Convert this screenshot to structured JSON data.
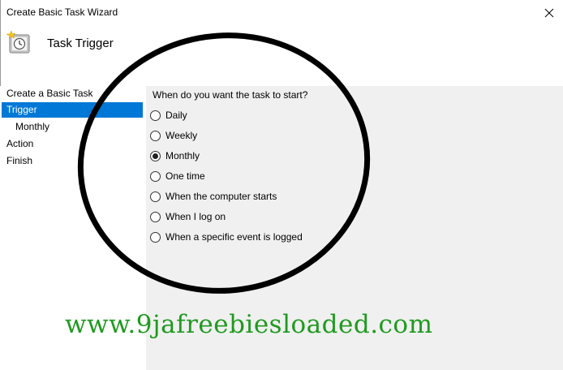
{
  "window": {
    "title": "Create Basic Task Wizard",
    "close_icon": "close-icon"
  },
  "header": {
    "title": "Task Trigger",
    "icon": "clock-icon"
  },
  "sidebar": {
    "items": [
      {
        "label": "Create a Basic Task",
        "selected": false,
        "indent": false
      },
      {
        "label": "Trigger",
        "selected": true,
        "indent": false
      },
      {
        "label": "Monthly",
        "selected": false,
        "indent": true
      },
      {
        "label": "Action",
        "selected": false,
        "indent": false
      },
      {
        "label": "Finish",
        "selected": false,
        "indent": false
      }
    ]
  },
  "main": {
    "prompt": "When do you want the task to start?",
    "options": [
      {
        "label": "Daily",
        "selected": false
      },
      {
        "label": "Weekly",
        "selected": false
      },
      {
        "label": "Monthly",
        "selected": true
      },
      {
        "label": "One time",
        "selected": false
      },
      {
        "label": "When the computer starts",
        "selected": false
      },
      {
        "label": "When I log on",
        "selected": false
      },
      {
        "label": "When a specific event is logged",
        "selected": false
      }
    ]
  },
  "watermark": {
    "text": "www.9jafreebiesloaded.com",
    "color": "#1f9a1f"
  },
  "colors": {
    "selection": "#0078d7",
    "panel": "#f0f0f0",
    "annotation_circle": "#000000"
  }
}
